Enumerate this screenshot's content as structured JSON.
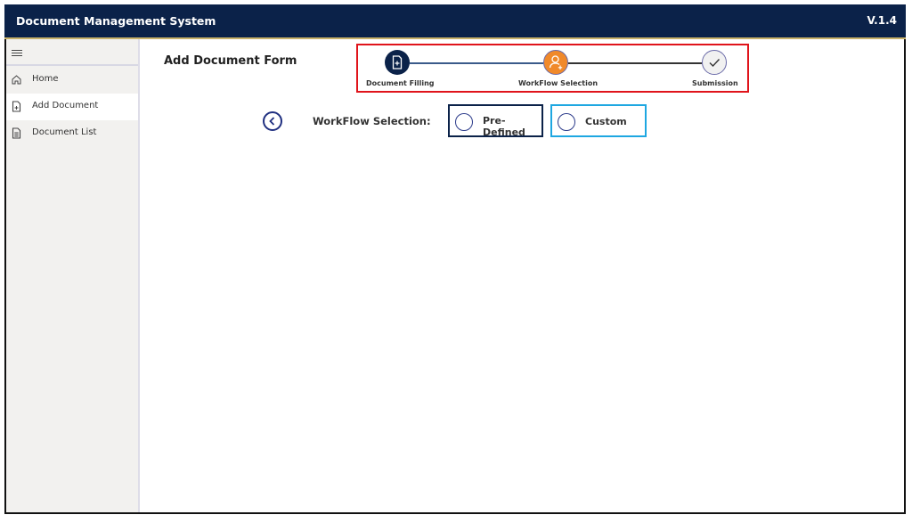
{
  "header": {
    "title": "Document Management System",
    "version": "V.1.4"
  },
  "sidebar": {
    "menu_icon": "hamburger-icon",
    "items": [
      {
        "label": "Home",
        "icon": "home-icon",
        "active": false
      },
      {
        "label": "Add Document",
        "icon": "document-add-icon",
        "active": true
      },
      {
        "label": "Document List",
        "icon": "document-list-icon",
        "active": false
      }
    ]
  },
  "page": {
    "title": "Add Document Form"
  },
  "stepper": {
    "steps": [
      {
        "label": "Document Filling",
        "icon": "document-add-icon",
        "state": "completed",
        "color": "#0b2249"
      },
      {
        "label": "WorkFlow Selection",
        "icon": "user-add-icon",
        "state": "current",
        "color": "#f0892a"
      },
      {
        "label": "Submission",
        "icon": "check-icon",
        "state": "pending",
        "color": "#f1f1f1"
      }
    ]
  },
  "workflow": {
    "label": "WorkFlow Selection:",
    "options": [
      {
        "label": "Pre-Defined",
        "selected": false,
        "border_color": "#0b2249"
      },
      {
        "label": "Custom",
        "selected": false,
        "border_color": "#1ea7e1"
      }
    ]
  },
  "colors": {
    "header_bg": "#0b2249",
    "accent_border": "#e0141b",
    "step_current": "#f0892a"
  }
}
